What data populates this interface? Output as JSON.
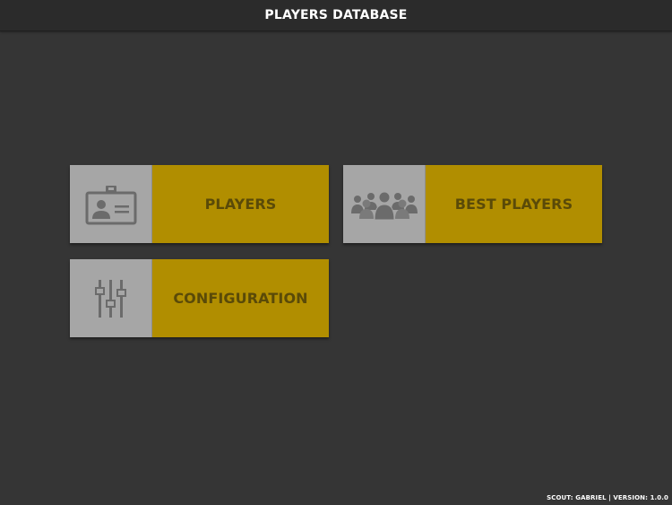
{
  "header": {
    "title": "PLAYERS DATABASE"
  },
  "menu": {
    "players": {
      "label": "PLAYERS",
      "icon": "id-card-icon"
    },
    "best_players": {
      "label": "BEST PLAYERS",
      "icon": "group-icon"
    },
    "configuration": {
      "label": "CONFIGURATION",
      "icon": "sliders-icon"
    }
  },
  "footer": {
    "text": "SCOUT: GABRIEL | VERSION: 1.0.0"
  },
  "colors": {
    "background": "#353535",
    "topbar": "#2b2b2b",
    "tile_icon_bg": "#a6a6a6",
    "tile_accent": "#b18e00",
    "tile_text": "#5a4a08",
    "icon_gray": "#6b6b6b"
  }
}
